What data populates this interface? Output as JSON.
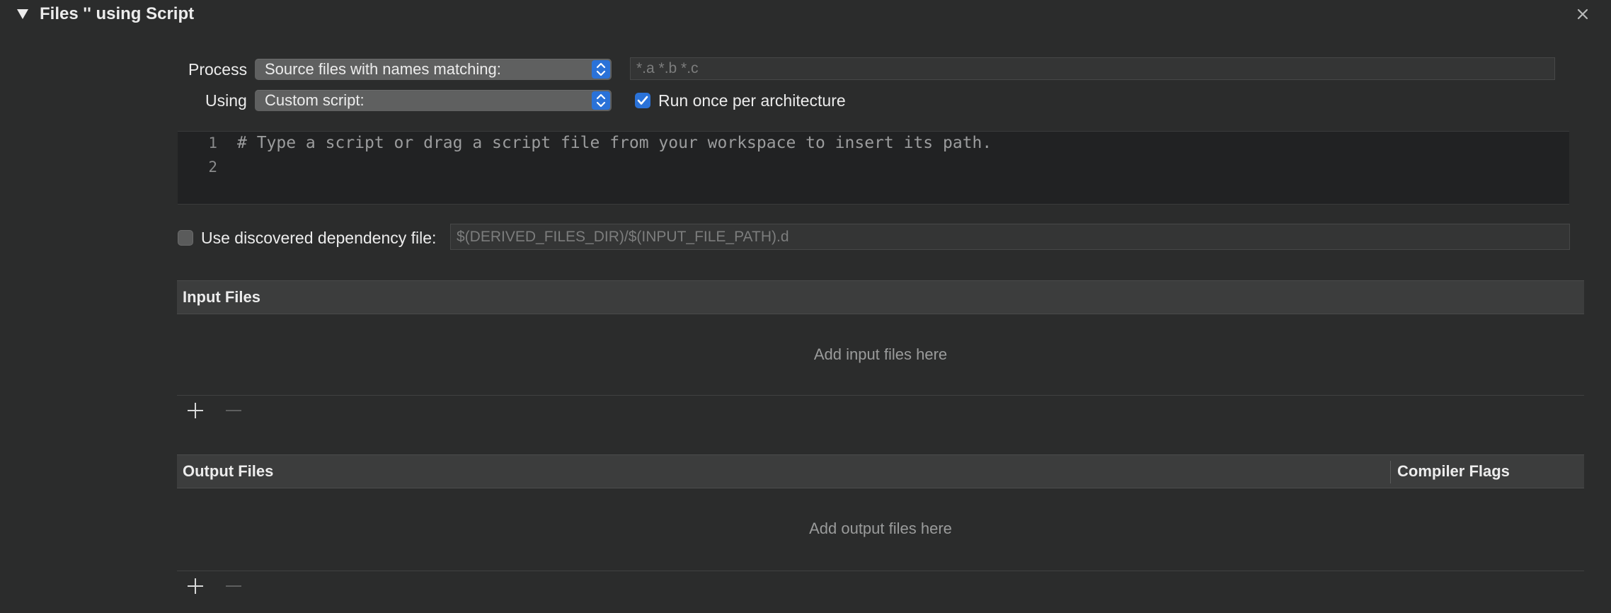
{
  "section": {
    "title": "Files '' using Script",
    "disclosure_icon": "disclosure-triangle-expanded-icon",
    "close_icon": "close-icon"
  },
  "process": {
    "label": "Process",
    "selected": "Source files with names matching:",
    "pattern_placeholder": "*.a *.b *.c",
    "pattern_value": ""
  },
  "using": {
    "label": "Using",
    "selected": "Custom script:"
  },
  "run_once": {
    "label": "Run once per architecture",
    "checked": true
  },
  "script_editor": {
    "line_numbers": [
      "1",
      "2"
    ],
    "lines": [
      "# Type a script or drag a script file from your workspace to insert its path.",
      ""
    ]
  },
  "dependency": {
    "label": "Use discovered dependency file:",
    "checked": false,
    "placeholder": "$(DERIVED_FILES_DIR)/$(INPUT_FILE_PATH).d"
  },
  "input_files": {
    "header": "Input Files",
    "empty_text": "Add input files here",
    "add_icon": "plus-icon",
    "remove_icon": "minus-icon"
  },
  "output_files": {
    "header": "Output Files",
    "compiler_flags_header": "Compiler Flags",
    "empty_text": "Add output files here",
    "add_icon": "plus-icon",
    "remove_icon": "minus-icon"
  },
  "colors": {
    "background": "#2b2c2c",
    "accent": "#2a72d8",
    "editor_background": "#212223",
    "table_header": "#3c3d3d"
  }
}
